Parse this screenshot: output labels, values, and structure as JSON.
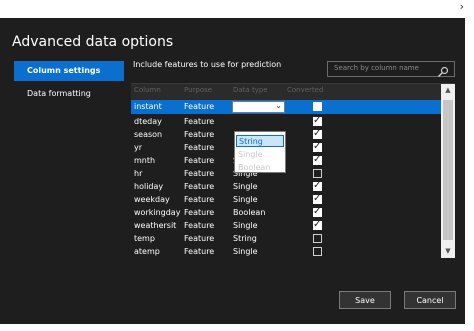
{
  "window": {
    "top_chevron": "›"
  },
  "dialog": {
    "title": "Advanced data options",
    "nav": {
      "active": "Column settings",
      "other": "Data formatting"
    },
    "include_label": "Include features to use for prediction",
    "search": {
      "placeholder": "Search by column name"
    },
    "grid": {
      "headers": [
        "Column",
        "Purpose",
        "Data type",
        "Converted"
      ],
      "rows": [
        {
          "column": "instant",
          "purpose": "Feature",
          "type": "",
          "checked": false,
          "selected": true
        },
        {
          "column": "dteday",
          "purpose": "Feature",
          "type": "",
          "checked": true
        },
        {
          "column": "season",
          "purpose": "Feature",
          "type": "",
          "checked": true
        },
        {
          "column": "yr",
          "purpose": "Feature",
          "type": "",
          "checked": true
        },
        {
          "column": "mnth",
          "purpose": "Feature",
          "type": "Single",
          "checked": true
        },
        {
          "column": "hr",
          "purpose": "Feature",
          "type": "Single",
          "checked": false
        },
        {
          "column": "holiday",
          "purpose": "Feature",
          "type": "Single",
          "checked": true
        },
        {
          "column": "weekday",
          "purpose": "Feature",
          "type": "Single",
          "checked": true
        },
        {
          "column": "workingday",
          "purpose": "Feature",
          "type": "Boolean",
          "checked": true
        },
        {
          "column": "weathersit",
          "purpose": "Feature",
          "type": "Single",
          "checked": true
        },
        {
          "column": "temp",
          "purpose": "Feature",
          "type": "String",
          "checked": false
        },
        {
          "column": "atemp",
          "purpose": "Feature",
          "type": "Single",
          "checked": false
        }
      ],
      "dropdown_options": [
        "String",
        "Single",
        "Boolean"
      ]
    },
    "buttons": {
      "save": "Save",
      "cancel": "Cancel"
    },
    "colors": {
      "background": "#1e1e1e",
      "accent": "#0a6fcf"
    }
  }
}
